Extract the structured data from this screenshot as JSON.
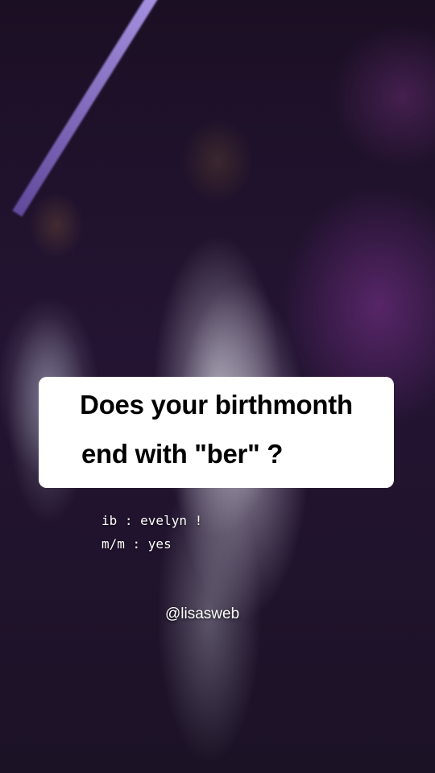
{
  "question": {
    "line1": "Does your birthmonth",
    "line2": "end with \"ber\" ?"
  },
  "notes": {
    "inspired_by": "ib : evelyn !",
    "my_month": "m/m : yes"
  },
  "watermark": "@lisasweb"
}
